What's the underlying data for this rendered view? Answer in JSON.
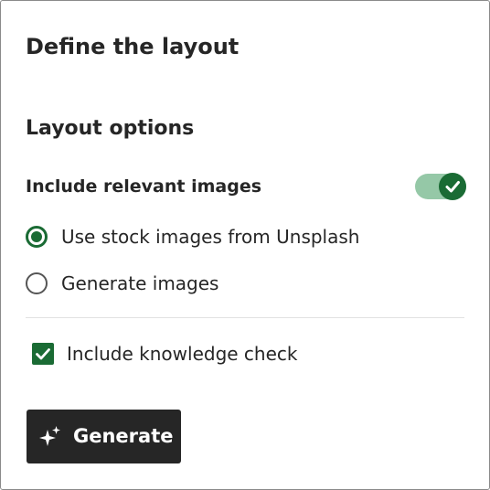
{
  "title": "Define the layout",
  "section_title": "Layout options",
  "images_toggle": {
    "label": "Include relevant images",
    "on": true
  },
  "image_source": {
    "options": [
      {
        "label": "Use stock images from Unsplash",
        "selected": true
      },
      {
        "label": "Generate images",
        "selected": false
      }
    ]
  },
  "knowledge_check": {
    "label": "Include knowledge check",
    "checked": true
  },
  "generate_button": {
    "label": "Generate",
    "icon": "sparkle-icon"
  },
  "colors": {
    "accent": "#1a6b34",
    "toggle_track": "#3e9a5e",
    "button_bg": "#262626",
    "text": "#262626",
    "border": "#8a8a8a"
  }
}
